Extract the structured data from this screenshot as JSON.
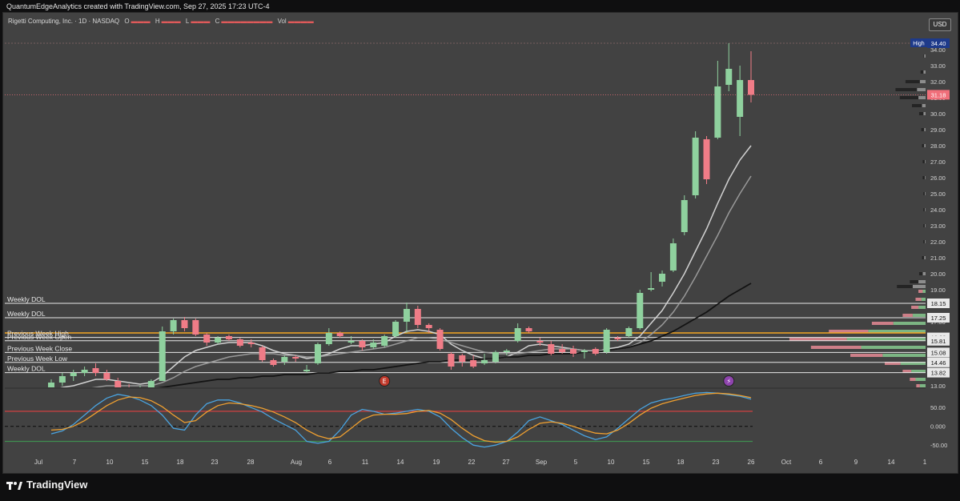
{
  "caption": "QuantumEdgeAnalytics created with TradingView.com, Sep 27, 2025 17:23 UTC-4",
  "legend": {
    "symbol": "Rigetti Computing, Inc. · 1D · NASDAQ",
    "o_key": "O",
    "h_key": "H",
    "l_key": "L",
    "c_key": "C",
    "vol_key": "Vol"
  },
  "currency_button": "USD",
  "branding": "TradingView",
  "chart_data": {
    "type": "candlestick",
    "price_axis": {
      "min": 13.0,
      "max": 34.5,
      "ticks": [
        "34.00",
        "33.00",
        "32.00",
        "31.00",
        "30.00",
        "29.00",
        "28.00",
        "27.00",
        "26.00",
        "25.00",
        "24.00",
        "23.00",
        "22.00",
        "21.00",
        "20.00",
        "19.00",
        "18.00",
        "17.00",
        "16.00",
        "15.00",
        "14.00",
        "13.00"
      ]
    },
    "price_labels": [
      {
        "text": "High",
        "value": 34.4,
        "color": "#1e3a8a",
        "text_color": "#ffffff",
        "role": "tag"
      },
      {
        "text": "34.40",
        "value": 34.4,
        "color": "#1e3a8a",
        "text_color": "#ffffff"
      },
      {
        "text": "31.18",
        "value": 31.18,
        "color": "#f06f7a",
        "text_color": "#ffffff"
      },
      {
        "text": "18.15",
        "value": 18.15,
        "color": "#e8e8e8",
        "text_color": "#111111"
      },
      {
        "text": "17.25",
        "value": 17.25,
        "color": "#e8e8e8",
        "text_color": "#111111"
      },
      {
        "text": "16.02",
        "value": 16.02,
        "color": "#e8e8e8",
        "text_color": "#111111"
      },
      {
        "text": "15.81",
        "value": 15.81,
        "color": "#e8e8e8",
        "text_color": "#111111"
      },
      {
        "text": "15.08",
        "value": 15.08,
        "color": "#e8e8e8",
        "text_color": "#111111"
      },
      {
        "text": "14.46",
        "value": 14.46,
        "color": "#e8e8e8",
        "text_color": "#111111"
      },
      {
        "text": "13.82",
        "value": 13.82,
        "color": "#e8e8e8",
        "text_color": "#111111"
      }
    ],
    "x_axis": {
      "ticks": [
        "Jul",
        "7",
        "10",
        "15",
        "18",
        "23",
        "28",
        "Aug",
        "6",
        "11",
        "14",
        "19",
        "22",
        "27",
        "Sep",
        "5",
        "10",
        "15",
        "18",
        "23",
        "26",
        "Oct",
        "6",
        "9",
        "14",
        "1"
      ]
    },
    "candles": [
      {
        "o": 12.7,
        "h": 13.4,
        "l": 12.5,
        "c": 13.2
      },
      {
        "o": 13.2,
        "h": 13.8,
        "l": 13.0,
        "c": 13.6
      },
      {
        "o": 13.6,
        "h": 14.0,
        "l": 13.3,
        "c": 13.8
      },
      {
        "o": 13.8,
        "h": 14.2,
        "l": 13.6,
        "c": 14.0
      },
      {
        "o": 14.1,
        "h": 14.4,
        "l": 13.6,
        "c": 13.8
      },
      {
        "o": 13.8,
        "h": 14.0,
        "l": 13.3,
        "c": 13.4
      },
      {
        "o": 13.3,
        "h": 13.5,
        "l": 12.8,
        "c": 12.9
      },
      {
        "o": 12.9,
        "h": 13.1,
        "l": 12.6,
        "c": 12.8
      },
      {
        "o": 12.8,
        "h": 13.0,
        "l": 12.6,
        "c": 12.9
      },
      {
        "o": 12.9,
        "h": 13.4,
        "l": 12.8,
        "c": 13.3
      },
      {
        "o": 13.3,
        "h": 16.7,
        "l": 13.3,
        "c": 16.4
      },
      {
        "o": 16.4,
        "h": 17.2,
        "l": 16.2,
        "c": 17.1
      },
      {
        "o": 17.1,
        "h": 17.3,
        "l": 16.4,
        "c": 16.6
      },
      {
        "o": 17.1,
        "h": 17.2,
        "l": 16.1,
        "c": 16.2
      },
      {
        "o": 16.2,
        "h": 16.3,
        "l": 15.5,
        "c": 15.7
      },
      {
        "o": 15.7,
        "h": 16.1,
        "l": 15.6,
        "c": 16.0
      },
      {
        "o": 16.1,
        "h": 16.2,
        "l": 15.8,
        "c": 15.9
      },
      {
        "o": 15.9,
        "h": 16.0,
        "l": 15.4,
        "c": 15.5
      },
      {
        "o": 15.7,
        "h": 15.9,
        "l": 15.4,
        "c": 15.6
      },
      {
        "o": 15.4,
        "h": 15.5,
        "l": 14.5,
        "c": 14.6
      },
      {
        "o": 14.6,
        "h": 14.7,
        "l": 14.2,
        "c": 14.3
      },
      {
        "o": 14.5,
        "h": 14.9,
        "l": 14.3,
        "c": 14.8
      },
      {
        "o": 14.8,
        "h": 14.9,
        "l": 14.5,
        "c": 14.7
      },
      {
        "o": 13.9,
        "h": 14.3,
        "l": 13.8,
        "c": 14.0
      },
      {
        "o": 14.4,
        "h": 15.7,
        "l": 14.3,
        "c": 15.6
      },
      {
        "o": 15.6,
        "h": 16.6,
        "l": 15.5,
        "c": 16.3
      },
      {
        "o": 16.3,
        "h": 16.4,
        "l": 16.0,
        "c": 16.1
      },
      {
        "o": 15.7,
        "h": 16.1,
        "l": 15.6,
        "c": 15.8
      },
      {
        "o": 15.8,
        "h": 15.9,
        "l": 15.2,
        "c": 15.4
      },
      {
        "o": 15.4,
        "h": 15.9,
        "l": 15.3,
        "c": 15.7
      },
      {
        "o": 15.5,
        "h": 16.2,
        "l": 15.4,
        "c": 16.1
      },
      {
        "o": 16.1,
        "h": 17.1,
        "l": 16.0,
        "c": 17.0
      },
      {
        "o": 17.0,
        "h": 18.2,
        "l": 16.3,
        "c": 17.8
      },
      {
        "o": 17.8,
        "h": 18.0,
        "l": 16.6,
        "c": 16.8
      },
      {
        "o": 16.8,
        "h": 16.9,
        "l": 16.3,
        "c": 16.6
      },
      {
        "o": 16.5,
        "h": 16.6,
        "l": 15.2,
        "c": 15.3
      },
      {
        "o": 15.0,
        "h": 15.1,
        "l": 14.0,
        "c": 14.2
      },
      {
        "o": 14.9,
        "h": 15.0,
        "l": 14.2,
        "c": 14.5
      },
      {
        "o": 14.6,
        "h": 14.9,
        "l": 14.1,
        "c": 14.2
      },
      {
        "o": 14.4,
        "h": 15.0,
        "l": 14.3,
        "c": 14.6
      },
      {
        "o": 14.5,
        "h": 15.2,
        "l": 14.4,
        "c": 15.1
      },
      {
        "o": 15.1,
        "h": 15.3,
        "l": 14.9,
        "c": 15.2
      },
      {
        "o": 15.8,
        "h": 16.9,
        "l": 15.7,
        "c": 16.6
      },
      {
        "o": 16.6,
        "h": 16.7,
        "l": 16.3,
        "c": 16.4
      },
      {
        "o": 15.8,
        "h": 16.0,
        "l": 15.5,
        "c": 15.7
      },
      {
        "o": 15.6,
        "h": 15.8,
        "l": 14.9,
        "c": 15.0
      },
      {
        "o": 15.3,
        "h": 15.6,
        "l": 15.0,
        "c": 15.1
      },
      {
        "o": 15.3,
        "h": 15.5,
        "l": 14.8,
        "c": 15.0
      },
      {
        "o": 15.1,
        "h": 15.3,
        "l": 14.7,
        "c": 15.2
      },
      {
        "o": 15.3,
        "h": 15.4,
        "l": 14.9,
        "c": 15.0
      },
      {
        "o": 15.1,
        "h": 16.6,
        "l": 15.0,
        "c": 16.5
      },
      {
        "o": 16.0,
        "h": 16.1,
        "l": 15.8,
        "c": 15.9
      },
      {
        "o": 16.1,
        "h": 16.7,
        "l": 16.0,
        "c": 16.6
      },
      {
        "o": 16.6,
        "h": 19.0,
        "l": 16.5,
        "c": 18.8
      },
      {
        "o": 19.0,
        "h": 20.1,
        "l": 18.9,
        "c": 19.1
      },
      {
        "o": 19.5,
        "h": 20.2,
        "l": 19.2,
        "c": 20.0
      },
      {
        "o": 20.2,
        "h": 22.2,
        "l": 20.1,
        "c": 21.9
      },
      {
        "o": 22.6,
        "h": 24.9,
        "l": 22.4,
        "c": 24.6
      },
      {
        "o": 24.9,
        "h": 28.9,
        "l": 24.7,
        "c": 28.5
      },
      {
        "o": 28.4,
        "h": 28.6,
        "l": 25.6,
        "c": 25.9
      },
      {
        "o": 28.5,
        "h": 33.3,
        "l": 28.4,
        "c": 31.7
      },
      {
        "o": 31.8,
        "h": 34.4,
        "l": 31.4,
        "c": 32.8
      },
      {
        "o": 29.8,
        "h": 33.0,
        "l": 28.6,
        "c": 32.1
      },
      {
        "o": 32.1,
        "h": 33.9,
        "l": 30.7,
        "c": 31.18
      }
    ],
    "moving_averages": [
      {
        "name": "",
        "color": "#d9d9d9",
        "values": [
          12.7,
          12.9,
          13.0,
          13.2,
          13.4,
          13.4,
          13.3,
          13.2,
          13.1,
          13.2,
          13.6,
          14.2,
          14.8,
          15.2,
          15.4,
          15.6,
          15.7,
          15.7,
          15.7,
          15.5,
          15.2,
          15.0,
          14.9,
          14.7,
          14.8,
          15.0,
          15.3,
          15.5,
          15.5,
          15.6,
          15.7,
          16.1,
          16.4,
          16.5,
          16.4,
          16.2,
          15.6,
          15.2,
          14.9,
          14.7,
          14.7,
          14.8,
          15.1,
          15.5,
          15.6,
          15.5,
          15.4,
          15.3,
          15.2,
          15.1,
          15.3,
          15.4,
          15.6,
          16.1,
          16.9,
          17.7,
          18.8,
          20.0,
          21.4,
          22.8,
          24.4,
          25.9,
          27.1,
          28.0
        ]
      },
      {
        "name": "",
        "color": "#9e9e9e",
        "values": [
          12.5,
          12.6,
          12.7,
          12.8,
          12.9,
          13.0,
          13.0,
          13.0,
          13.0,
          13.0,
          13.2,
          13.5,
          13.9,
          14.2,
          14.4,
          14.6,
          14.8,
          14.9,
          15.0,
          15.0,
          15.0,
          14.9,
          14.9,
          14.8,
          14.8,
          14.9,
          15.0,
          15.1,
          15.2,
          15.3,
          15.4,
          15.6,
          15.8,
          16.0,
          16.0,
          15.9,
          15.7,
          15.5,
          15.3,
          15.1,
          15.0,
          15.0,
          15.0,
          15.1,
          15.2,
          15.3,
          15.3,
          15.3,
          15.2,
          15.2,
          15.2,
          15.3,
          15.4,
          15.7,
          16.2,
          16.8,
          17.6,
          18.6,
          19.8,
          21.1,
          22.4,
          23.8,
          25.0,
          26.1
        ]
      },
      {
        "name": "",
        "color": "#111111",
        "values": [
          12.0,
          12.1,
          12.2,
          12.3,
          12.4,
          12.5,
          12.5,
          12.6,
          12.7,
          12.8,
          12.9,
          13.0,
          13.1,
          13.2,
          13.3,
          13.4,
          13.4,
          13.5,
          13.5,
          13.6,
          13.6,
          13.7,
          13.7,
          13.7,
          13.8,
          13.8,
          13.9,
          13.9,
          14.0,
          14.0,
          14.1,
          14.2,
          14.3,
          14.4,
          14.5,
          14.5,
          14.6,
          14.6,
          14.6,
          14.7,
          14.7,
          14.8,
          14.8,
          14.9,
          14.9,
          15.0,
          15.0,
          15.0,
          15.1,
          15.1,
          15.2,
          15.3,
          15.4,
          15.6,
          15.8,
          16.1,
          16.4,
          16.8,
          17.2,
          17.6,
          18.1,
          18.6,
          19.0,
          19.4
        ]
      }
    ],
    "levels": [
      {
        "label": "Weekly DOL",
        "value": 18.15,
        "color": "#e8e8e8"
      },
      {
        "label": "Weekly DOL",
        "value": 17.25,
        "color": "#e8e8e8"
      },
      {
        "label": "Previous Week High",
        "value": 16.02,
        "color": "#e8e8e8"
      },
      {
        "label": "Previous Week Open",
        "value": 15.81,
        "color": "#e8e8e8"
      },
      {
        "label": "Previous Week Close",
        "value": 15.08,
        "color": "#e8e8e8"
      },
      {
        "label": "Previous Week Low",
        "value": 14.46,
        "color": "#e8e8e8"
      },
      {
        "label": "Weekly DOL",
        "value": 13.82,
        "color": "#e8e8e8"
      }
    ],
    "orange_level": {
      "value": 16.3,
      "color": "#f5a623"
    },
    "event_markers": [
      {
        "glyph": "E",
        "color": "#c0392b",
        "index": 30
      },
      {
        "glyph": "⚡",
        "color": "#8e44ad",
        "index": 61
      }
    ],
    "oscillator": {
      "ticks": [
        "50.00",
        "0.000",
        "-50.00"
      ],
      "range": [
        -75,
        95
      ],
      "upper_line": 40,
      "zero_line": 0,
      "lower_line": -40,
      "blue": [
        -20,
        -12,
        5,
        30,
        55,
        75,
        85,
        80,
        70,
        55,
        30,
        -5,
        -10,
        30,
        60,
        70,
        70,
        62,
        50,
        38,
        20,
        5,
        -10,
        -40,
        -45,
        -40,
        -10,
        30,
        45,
        40,
        32,
        35,
        40,
        45,
        40,
        25,
        -5,
        -30,
        -50,
        -55,
        -50,
        -40,
        -15,
        15,
        25,
        15,
        5,
        -10,
        -25,
        -35,
        -28,
        -5,
        20,
        45,
        62,
        70,
        75,
        82,
        88,
        90,
        88,
        84,
        80,
        72
      ],
      "orange": [
        -10,
        -8,
        0,
        15,
        35,
        55,
        70,
        78,
        76,
        68,
        52,
        30,
        10,
        15,
        38,
        55,
        62,
        60,
        55,
        48,
        38,
        25,
        10,
        -10,
        -25,
        -33,
        -28,
        -5,
        18,
        30,
        32,
        32,
        34,
        40,
        42,
        35,
        18,
        -5,
        -25,
        -38,
        -42,
        -40,
        -28,
        -8,
        8,
        12,
        8,
        0,
        -10,
        -18,
        -20,
        -10,
        8,
        30,
        48,
        60,
        68,
        75,
        82,
        86,
        88,
        86,
        82,
        76
      ]
    },
    "volume_profile": [
      {
        "value": 33.6,
        "buy": 2,
        "sell": 1
      },
      {
        "value": 32.6,
        "buy": 3,
        "sell": 4
      },
      {
        "value": 32.0,
        "buy": 8,
        "sell": 20
      },
      {
        "value": 31.5,
        "buy": 12,
        "sell": 30
      },
      {
        "value": 31.0,
        "buy": 10,
        "sell": 26
      },
      {
        "value": 30.5,
        "buy": 5,
        "sell": 14
      },
      {
        "value": 30.0,
        "buy": 3,
        "sell": 6
      },
      {
        "value": 29.0,
        "buy": 2,
        "sell": 4
      },
      {
        "value": 28.0,
        "buy": 2,
        "sell": 3
      },
      {
        "value": 27.0,
        "buy": 1,
        "sell": 3
      },
      {
        "value": 26.0,
        "buy": 1,
        "sell": 3
      },
      {
        "value": 25.0,
        "buy": 1,
        "sell": 2
      },
      {
        "value": 24.0,
        "buy": 1,
        "sell": 2
      },
      {
        "value": 23.0,
        "buy": 1,
        "sell": 2
      },
      {
        "value": 22.0,
        "buy": 1,
        "sell": 2
      },
      {
        "value": 21.0,
        "buy": 2,
        "sell": 3
      },
      {
        "value": 20.0,
        "buy": 4,
        "sell": 5
      },
      {
        "value": 19.5,
        "buy": 10,
        "sell": 12
      },
      {
        "value": 19.2,
        "buy": 18,
        "sell": 22
      },
      {
        "value": 18.9,
        "buy": 4,
        "sell": 6
      },
      {
        "value": 18.4,
        "buy": 6,
        "sell": 8
      },
      {
        "value": 17.9,
        "buy": 10,
        "sell": 10
      },
      {
        "value": 17.4,
        "buy": 18,
        "sell": 14
      },
      {
        "value": 16.9,
        "buy": 45,
        "sell": 30
      },
      {
        "value": 16.4,
        "buy": 80,
        "sell": 55
      },
      {
        "value": 15.9,
        "buy": 110,
        "sell": 80
      },
      {
        "value": 15.4,
        "buy": 90,
        "sell": 70
      },
      {
        "value": 14.9,
        "buy": 60,
        "sell": 45
      },
      {
        "value": 14.4,
        "buy": 35,
        "sell": 22
      },
      {
        "value": 13.9,
        "buy": 20,
        "sell": 12
      },
      {
        "value": 13.4,
        "buy": 14,
        "sell": 8
      },
      {
        "value": 13.0,
        "buy": 8,
        "sell": 5
      }
    ]
  }
}
